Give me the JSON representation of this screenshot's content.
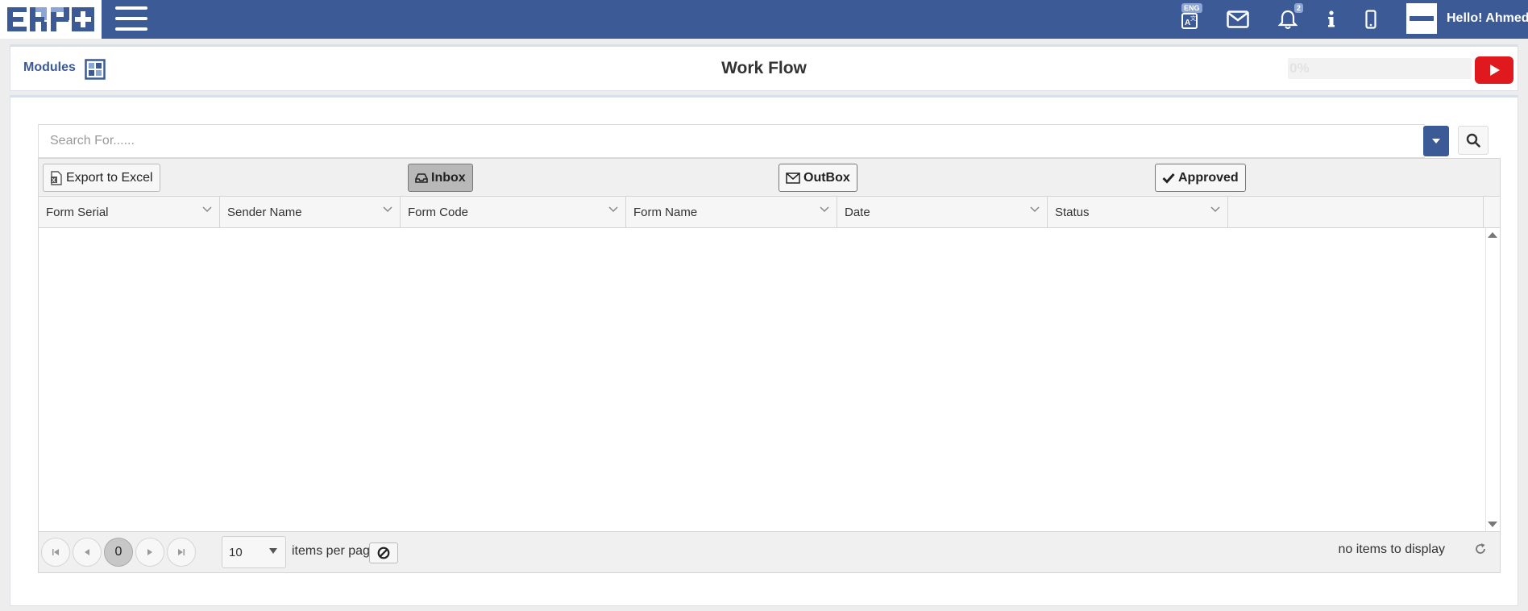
{
  "topbar": {
    "logo_text": "ERP+",
    "language_badge": "ENG",
    "notification_count": "2",
    "greeting": "Hello! Ahmed",
    "bg_color": "#3b5a96"
  },
  "header": {
    "modules_label": "Modules",
    "title": "Work Flow",
    "progress_text": "0%",
    "progress_value": 0
  },
  "search": {
    "placeholder": "Search For......"
  },
  "toolbar": {
    "export_label": "Export to Excel",
    "inbox_label": "Inbox",
    "outbox_label": "OutBox",
    "approved_label": "Approved"
  },
  "columns": [
    "Form Serial",
    "Sender Name",
    "Form Code",
    "Form Name",
    "Date",
    "Status"
  ],
  "pager": {
    "current_page": "0",
    "page_size": "10",
    "items_per_page_label": "items per page",
    "info": "no items to display"
  }
}
